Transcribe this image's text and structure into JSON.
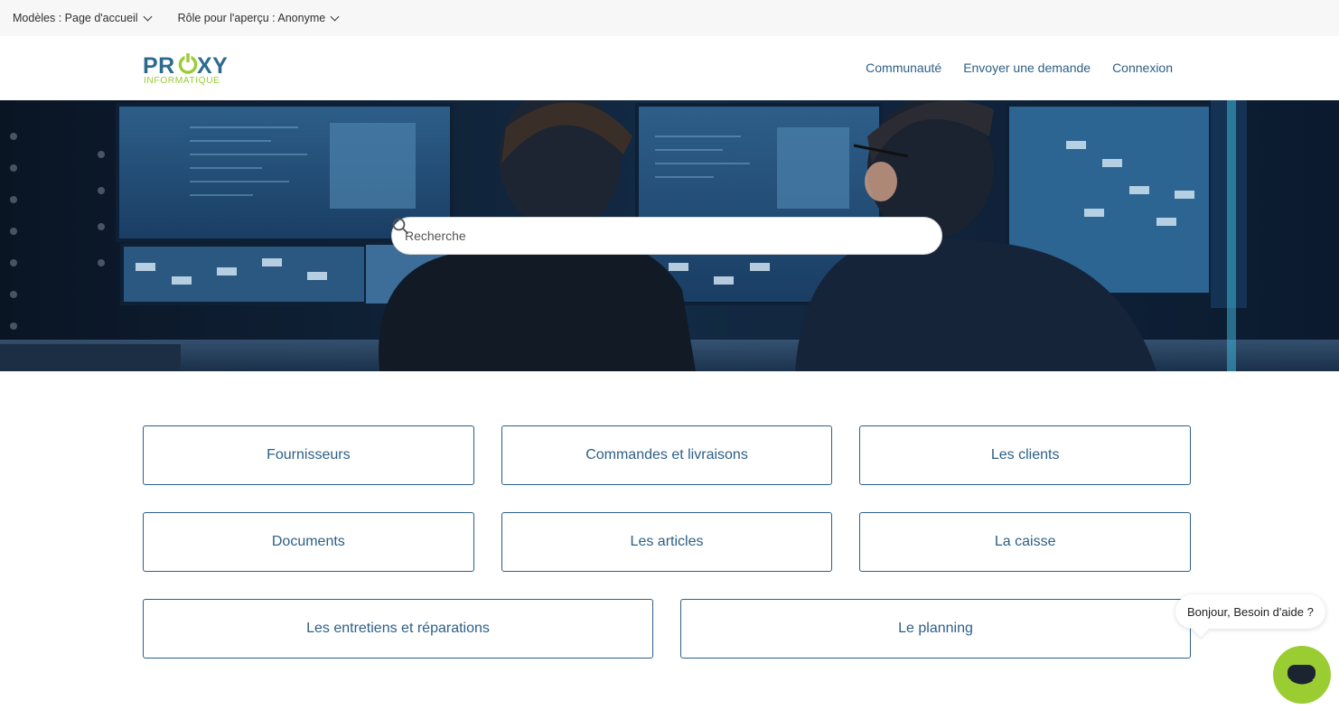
{
  "preview": {
    "template_label": "Modèles : Page d'accueil",
    "role_label": "Rôle pour l'aperçu : Anonyme"
  },
  "brand": {
    "name": "PROXY",
    "subtitle": "INFORMATIQUE",
    "color_primary": "#2c5f87",
    "color_accent": "#9acd32"
  },
  "nav": {
    "items": [
      "Communauté",
      "Envoyer une demande",
      "Connexion"
    ]
  },
  "search": {
    "placeholder": "Recherche",
    "icon": "search-icon"
  },
  "categories": [
    "Fournisseurs",
    "Commandes et livraisons",
    "Les clients",
    "Documents",
    "Les articles",
    "La caisse",
    "Les entretiens et réparations",
    "Le planning"
  ],
  "chat": {
    "greeting": "Bonjour, Besoin d'aide ?",
    "icon": "chat-icon"
  }
}
